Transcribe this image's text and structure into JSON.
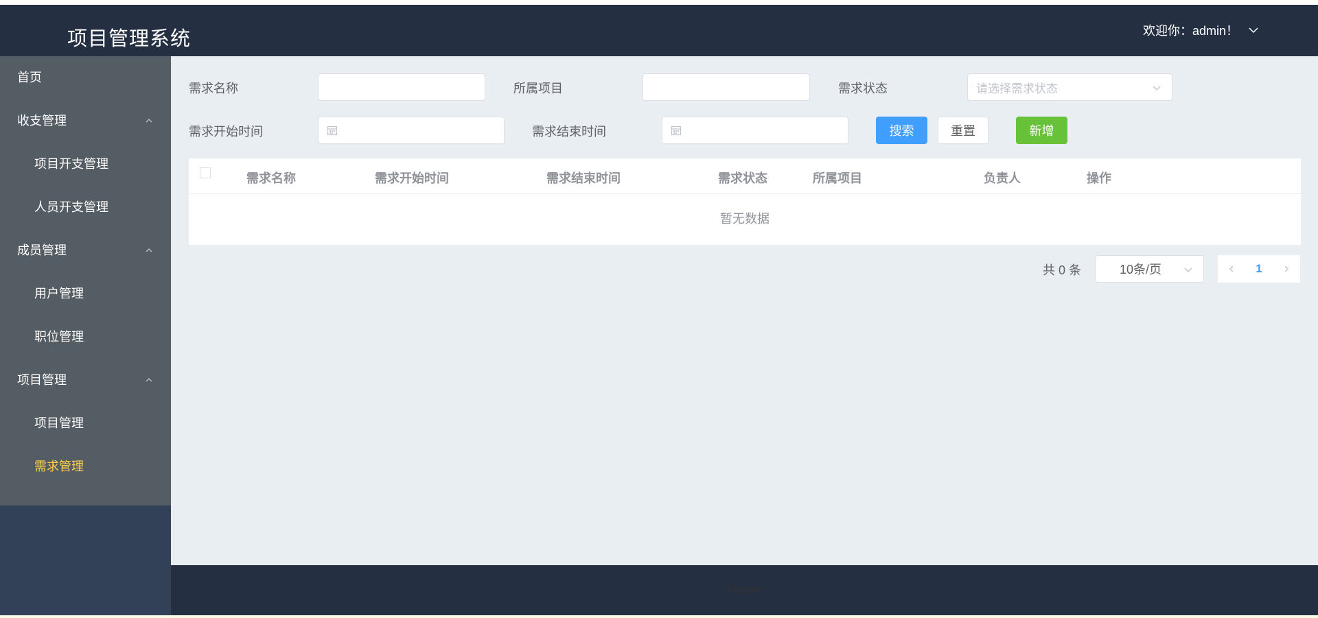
{
  "header": {
    "app_title": "项目管理系统",
    "user_greeting": "欢迎你：admin！"
  },
  "sidebar": {
    "items": [
      {
        "label": "首页",
        "level": 1
      },
      {
        "label": "收支管理",
        "level": 1,
        "expanded": true
      },
      {
        "label": "项目开支管理",
        "level": 2
      },
      {
        "label": "人员开支管理",
        "level": 2
      },
      {
        "label": "成员管理",
        "level": 1,
        "expanded": true
      },
      {
        "label": "用户管理",
        "level": 2
      },
      {
        "label": "职位管理",
        "level": 2
      },
      {
        "label": "项目管理",
        "level": 1,
        "expanded": true
      },
      {
        "label": "项目管理",
        "level": 2
      },
      {
        "label": "需求管理",
        "level": 2,
        "active": true
      }
    ],
    "active_color": "#ffd04b"
  },
  "search_form": {
    "name_label": "需求名称",
    "name_value": "",
    "project_label": "所属项目",
    "project_value": "",
    "status_label": "需求状态",
    "status_placeholder": "请选择需求状态",
    "start_label": "需求开始时间",
    "end_label": "需求结束时间",
    "search_button": "搜索",
    "reset_button": "重置",
    "add_button": "新增"
  },
  "table": {
    "columns": [
      "需求名称",
      "需求开始时间",
      "需求结束时间",
      "需求状态",
      "所属项目",
      "负责人",
      "操作"
    ],
    "rows": [],
    "empty_text": "暂无数据"
  },
  "pagination": {
    "total_text": "共 0 条",
    "page_size": "10条/页",
    "current_page": "1"
  },
  "footer": {
    "text": "Footer"
  },
  "colors": {
    "header_bg": "#242f42",
    "menu_bg": "#545c64",
    "primary": "#409eff",
    "success": "#67c23a"
  }
}
